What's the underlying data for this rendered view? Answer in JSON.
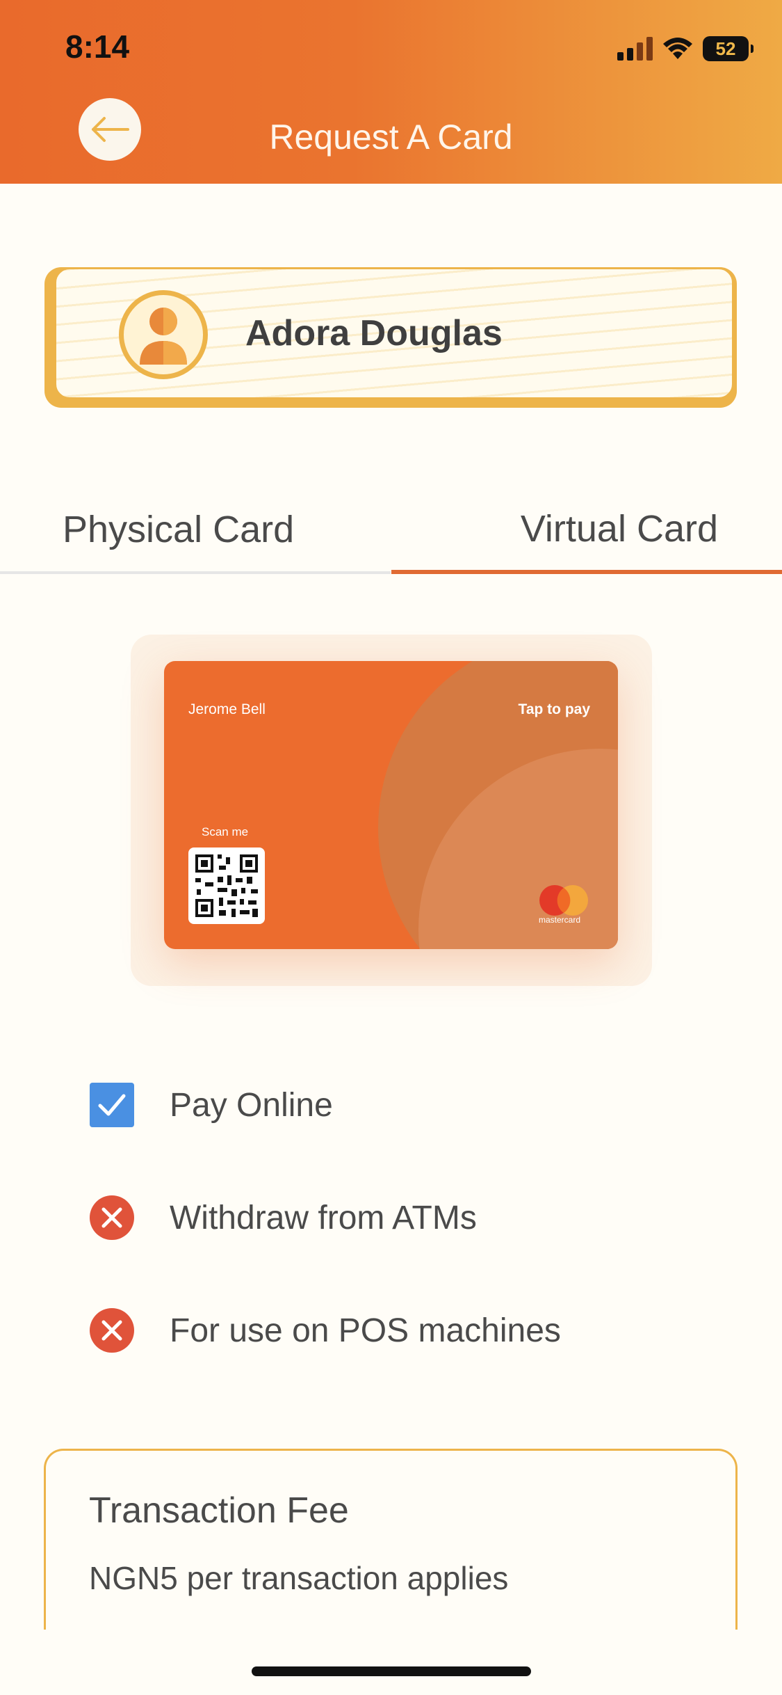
{
  "status": {
    "time": "8:14",
    "battery": "52"
  },
  "header": {
    "title": "Request A Card"
  },
  "profile": {
    "name": "Adora Douglas"
  },
  "tabs": [
    {
      "label": "Physical Card",
      "active": false
    },
    {
      "label": "Virtual Card",
      "active": true
    }
  ],
  "virtual_card": {
    "holder": "Jerome Bell",
    "tap": "Tap to pay",
    "scan": "Scan me",
    "brand": "mastercard"
  },
  "features": [
    {
      "label": "Pay Online",
      "enabled": true
    },
    {
      "label": "Withdraw from ATMs",
      "enabled": false
    },
    {
      "label": "For use on POS machines",
      "enabled": false
    }
  ],
  "fee": {
    "title": "Transaction Fee",
    "description": "NGN5 per transaction applies"
  },
  "colors": {
    "accent": "#E06B33",
    "gold": "#EDB44A",
    "checkbox": "#4A90E2",
    "error": "#E0533A"
  }
}
